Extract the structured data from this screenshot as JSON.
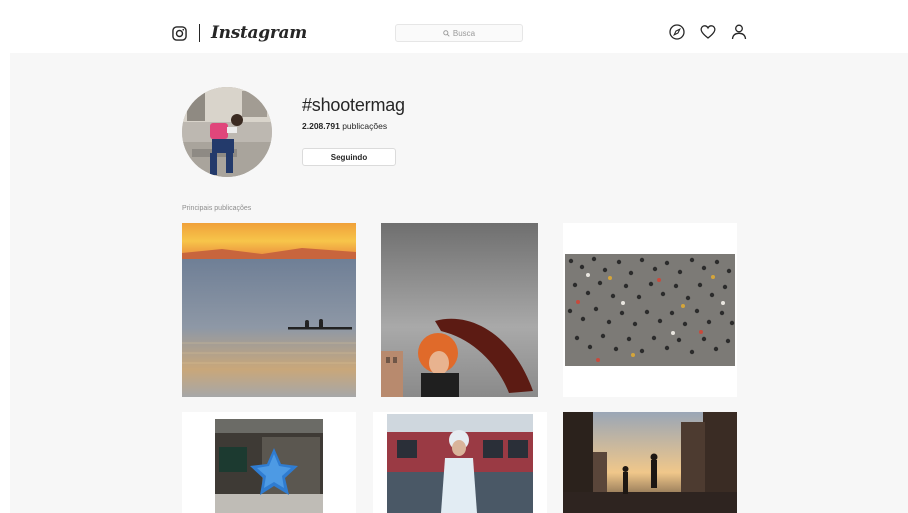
{
  "header": {
    "brand": "Instagram",
    "search_placeholder": "Busca",
    "icons": [
      "instagram-camera-icon",
      "explore-compass-icon",
      "activity-heart-icon",
      "profile-person-icon"
    ]
  },
  "tag_page": {
    "hashtag": "#shootermag",
    "post_count": "2.208.791",
    "post_count_suffix": "publicações",
    "follow_button": "Seguindo"
  },
  "top_posts": {
    "title": "Principais publicações",
    "items": [
      {
        "name": "sunset-sea-kayakers"
      },
      {
        "name": "woman-red-umbrella"
      },
      {
        "name": "crowd-aerial"
      },
      {
        "name": "blue-star-balloon"
      },
      {
        "name": "woman-by-train"
      },
      {
        "name": "city-street-sunset"
      }
    ]
  },
  "colors": {
    "text": "#262626",
    "muted": "#8e8e8e",
    "border": "#dbdbdb",
    "background": "#f7f7f7"
  }
}
